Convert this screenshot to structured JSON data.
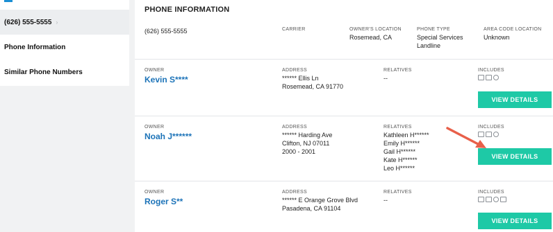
{
  "sidebar": {
    "active_phone": "(626) 555-5555",
    "items": [
      {
        "label": "Phone Information"
      },
      {
        "label": "Similar Phone Numbers"
      }
    ]
  },
  "main": {
    "section_title": "PHONE INFORMATION",
    "phone": {
      "number": "(626) 555-5555",
      "carrier_label": "CARRIER",
      "carrier_value": "",
      "location_label": "OWNER'S LOCATION",
      "location_value": "Rosemead, CA",
      "type_label": "PHONE TYPE",
      "type_line1": "Special Services",
      "type_line2": "Landline",
      "area_label": "AREA CODE LOCATION",
      "area_value": "Unknown"
    },
    "labels": {
      "owner": "OWNER",
      "address": "ADDRESS",
      "relatives": "RELATIVES",
      "includes": "INCLUDES"
    },
    "results": [
      {
        "name": "Kevin S****",
        "address": [
          "****** Ellis Ln",
          "Rosemead, CA 91770"
        ],
        "relatives": [
          "--"
        ],
        "icons": [
          "property-icon",
          "id-card-icon",
          "phone-icon"
        ],
        "button": "VIEW DETAILS"
      },
      {
        "name": "Noah J******",
        "address": [
          "****** Harding Ave",
          "Clifton, NJ 07011",
          "2000 - 2001"
        ],
        "relatives": [
          "Kathleen H******",
          "Emily H******",
          "Gail H******",
          "Kate H******",
          "Leo H******"
        ],
        "icons": [
          "property-icon",
          "id-card-icon",
          "phone-icon"
        ],
        "button": "VIEW DETAILS"
      },
      {
        "name": "Roger S**",
        "address": [
          "****** E Orange Grove Blvd",
          "Pasadena, CA 91104"
        ],
        "relatives": [
          "--"
        ],
        "icons": [
          "property-icon",
          "id-card-icon",
          "phone-icon",
          "email-icon"
        ],
        "button": "VIEW DETAILS"
      }
    ]
  },
  "colors": {
    "accent": "#1ec9a6",
    "link": "#1c73b8",
    "arrow": "#e8604a"
  }
}
